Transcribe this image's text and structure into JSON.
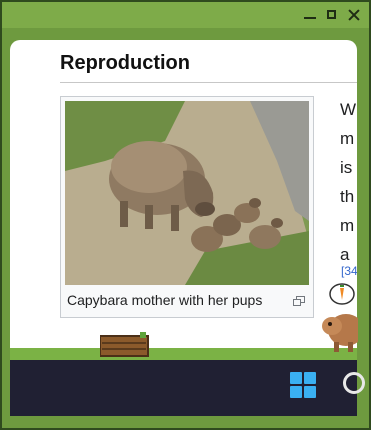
{
  "window": {
    "controls": {
      "minimize": "minimize-icon",
      "maximize": "maximize-icon",
      "close": "close-icon"
    }
  },
  "article": {
    "section_heading": "Reproduction",
    "figure": {
      "image_icon": "capybara-photo",
      "caption": "Capybara mother with her pups",
      "enlarge_icon": "enlarge-icon"
    },
    "side_text_letters": [
      "W",
      "m",
      "is",
      "th",
      "m",
      "a"
    ],
    "side_link": "[34"
  },
  "taskbar": {
    "start_icon": "windows-logo-icon",
    "search_icon": "search-icon"
  },
  "colors": {
    "frame_green": "#6e9a3f",
    "taskbar": "#202033",
    "link": "#3366cc",
    "windows_blue": "#3ab0f2"
  }
}
